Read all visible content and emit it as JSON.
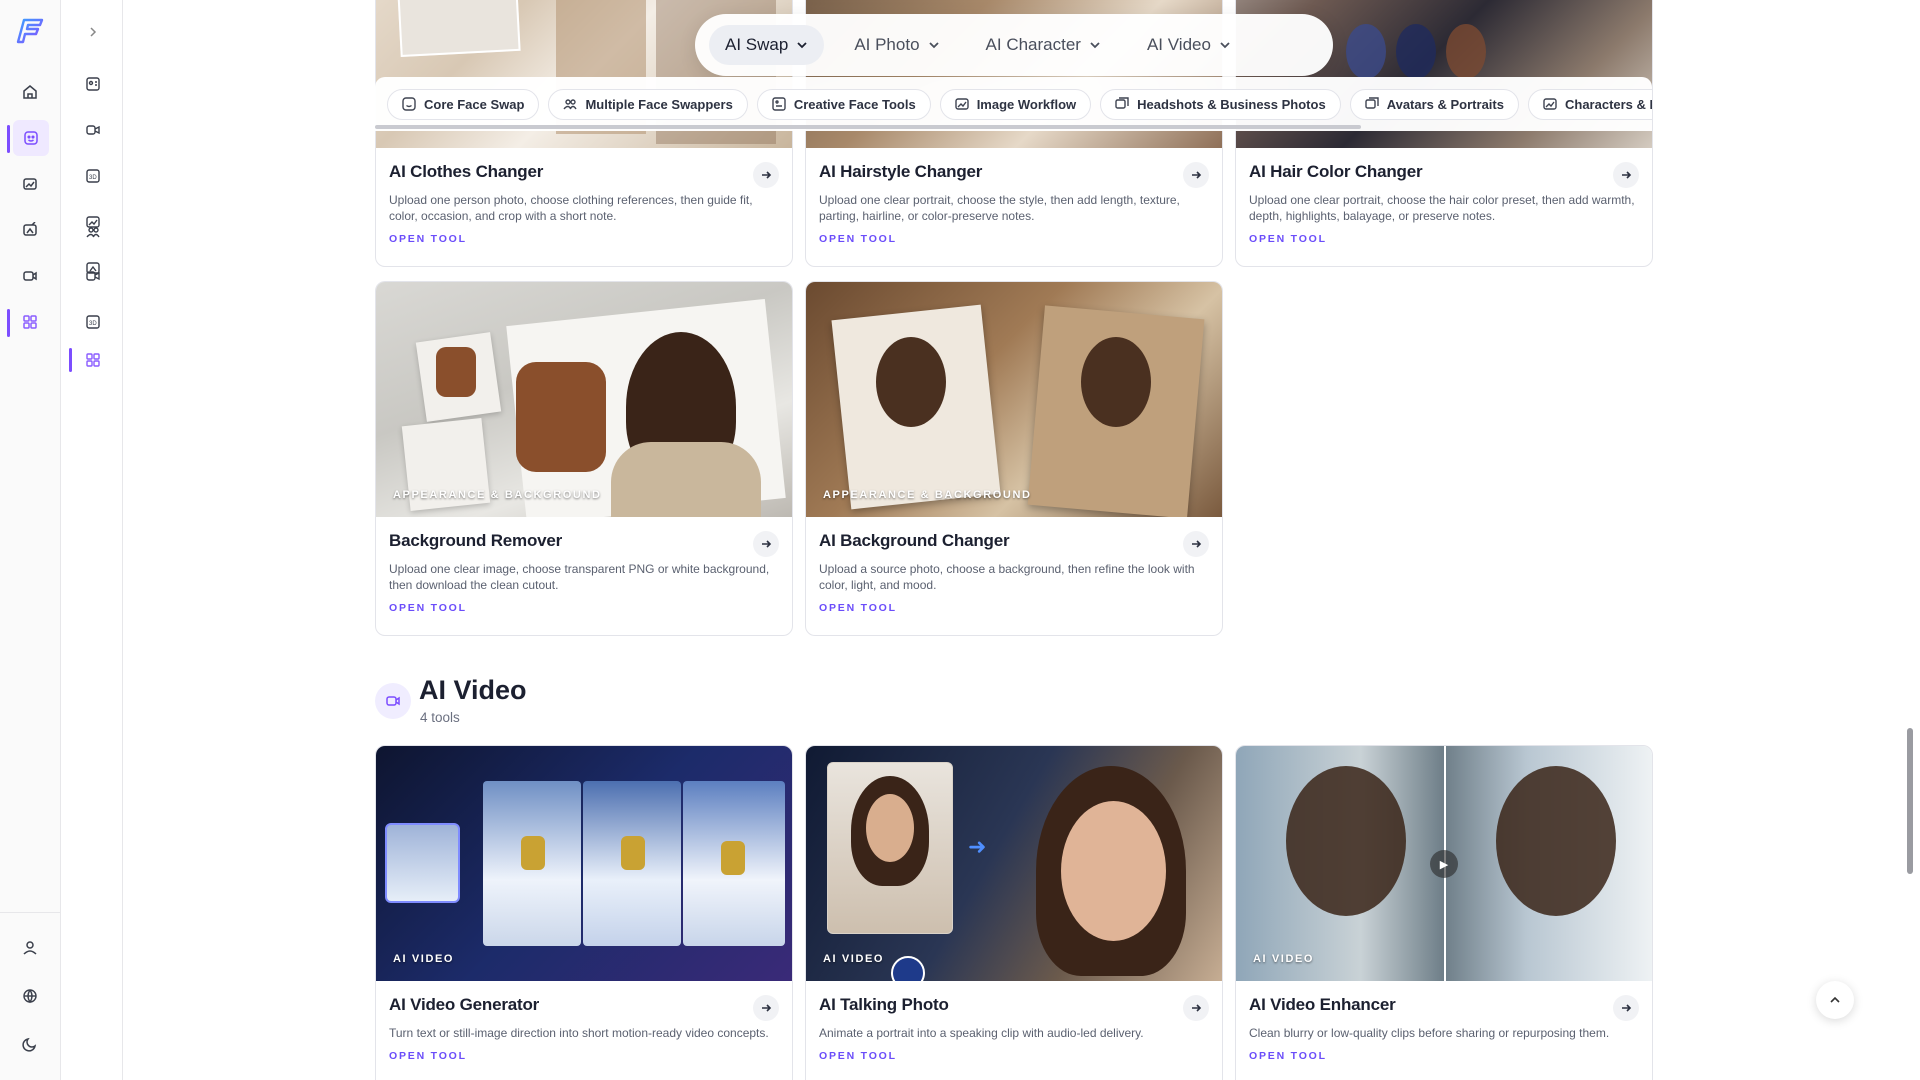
{
  "top_nav": {
    "items": [
      {
        "label": "AI Swap",
        "active": true
      },
      {
        "label": "AI Photo",
        "active": false
      },
      {
        "label": "AI Character",
        "active": false
      },
      {
        "label": "AI Video",
        "active": false
      }
    ]
  },
  "chips": [
    {
      "label": "Core Face Swap",
      "icon": "face-frame-icon"
    },
    {
      "label": "Multiple Face Swappers",
      "icon": "users-icon"
    },
    {
      "label": "Creative Face Tools",
      "icon": "palette-icon"
    },
    {
      "label": "Image Workflow",
      "icon": "image-edit-icon"
    },
    {
      "label": "Headshots & Business Photos",
      "icon": "images-icon"
    },
    {
      "label": "Avatars & Portraits",
      "icon": "images-icon"
    },
    {
      "label": "Characters & Persor",
      "icon": "image-edit-icon"
    }
  ],
  "cards_top": [
    {
      "title": "AI Clothes Changer",
      "desc": "Upload one person photo, choose clothing references, then guide fit, color, occasion, and crop with a short note.",
      "cta": "OPEN TOOL"
    },
    {
      "title": "AI Hairstyle Changer",
      "desc": "Upload one clear portrait, choose the style, then add length, texture, parting, hairline, or color-preserve notes.",
      "cta": "OPEN TOOL"
    },
    {
      "title": "AI Hair Color Changer",
      "desc": "Upload one clear portrait, choose the hair color preset, then add warmth, depth, highlights, balayage, or preserve notes.",
      "cta": "OPEN TOOL"
    }
  ],
  "cards_mid": [
    {
      "tag": "APPEARANCE & BACKGROUND",
      "title": "Background Remover",
      "desc": "Upload one clear image, choose transparent PNG or white background, then download the clean cutout.",
      "cta": "OPEN TOOL"
    },
    {
      "tag": "APPEARANCE & BACKGROUND",
      "title": "AI Background Changer",
      "desc": "Upload a source photo, choose a background, then refine the look with color, light, and mood.",
      "cta": "OPEN TOOL"
    }
  ],
  "section": {
    "title": "AI Video",
    "count": "4 tools"
  },
  "cards_video": [
    {
      "tag": "AI VIDEO",
      "title": "AI Video Generator",
      "desc": "Turn text or still-image direction into short motion-ready video concepts.",
      "cta": "OPEN TOOL"
    },
    {
      "tag": "AI VIDEO",
      "title": "AI Talking Photo",
      "desc": "Animate a portrait into a speaking clip with audio-led delivery.",
      "cta": "OPEN TOOL"
    },
    {
      "tag": "AI VIDEO",
      "title": "AI Video Enhancer",
      "desc": "Clean blurry or low-quality clips before sharing or repurposing them.",
      "cta": "OPEN TOOL"
    }
  ],
  "colors": {
    "accent": "#7c4dff",
    "cta": "#6b4dfa"
  }
}
